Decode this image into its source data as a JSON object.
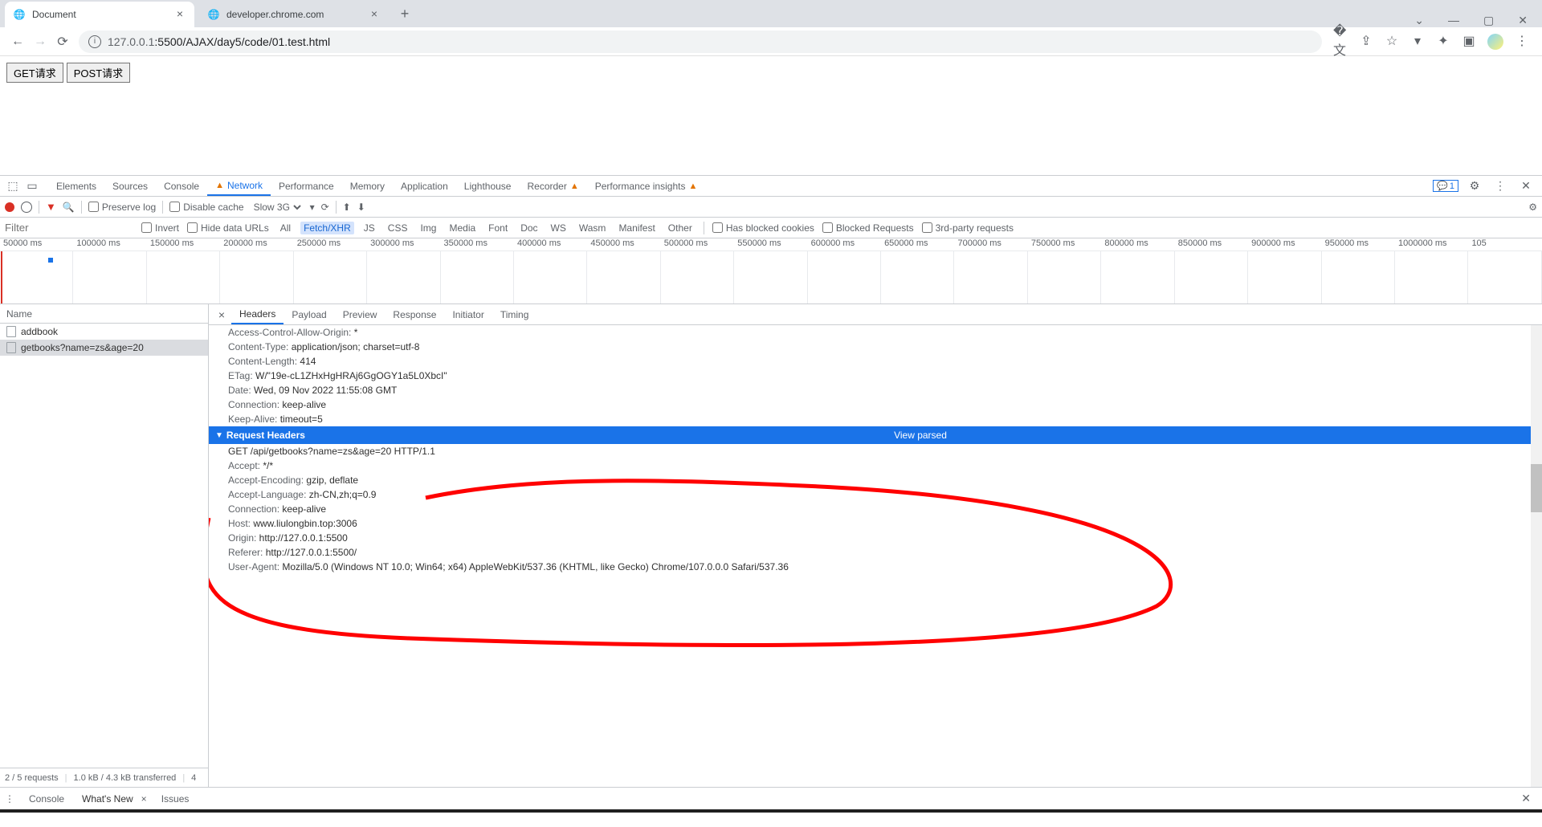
{
  "tabs": [
    {
      "title": "Document",
      "favicon": "globe"
    },
    {
      "title": "developer.chrome.com",
      "favicon": "globe"
    }
  ],
  "url": {
    "host": "127.0.0.1",
    "port": ":5500",
    "path": "/AJAX/day5/code/01.test.html"
  },
  "page_buttons": {
    "get": "GET请求",
    "post": "POST请求"
  },
  "devtools": {
    "panels": [
      "Elements",
      "Sources",
      "Console",
      "Network",
      "Performance",
      "Memory",
      "Application",
      "Lighthouse",
      "Recorder",
      "Performance insights"
    ],
    "active_panel": "Network",
    "msg_count": "1",
    "toolbar": {
      "preserve": "Preserve log",
      "disable_cache": "Disable cache",
      "throttle": "Slow 3G"
    },
    "filter": {
      "placeholder": "Filter",
      "invert": "Invert",
      "hide": "Hide data URLs",
      "types": [
        "All",
        "Fetch/XHR",
        "JS",
        "CSS",
        "Img",
        "Media",
        "Font",
        "Doc",
        "WS",
        "Wasm",
        "Manifest",
        "Other"
      ],
      "active_type": "Fetch/XHR",
      "blocked_cookies": "Has blocked cookies",
      "blocked_req": "Blocked Requests",
      "third": "3rd-party requests"
    },
    "timeline_ticks": [
      "50000 ms",
      "100000 ms",
      "150000 ms",
      "200000 ms",
      "250000 ms",
      "300000 ms",
      "350000 ms",
      "400000 ms",
      "450000 ms",
      "500000 ms",
      "550000 ms",
      "600000 ms",
      "650000 ms",
      "700000 ms",
      "750000 ms",
      "800000 ms",
      "850000 ms",
      "900000 ms",
      "950000 ms",
      "1000000 ms",
      "105"
    ],
    "requests": {
      "header": "Name",
      "rows": [
        "addbook",
        "getbooks?name=zs&age=20"
      ],
      "selected": 1,
      "status": {
        "count": "2 / 5 requests",
        "transferred": "1.0 kB / 4.3 kB transferred",
        "more": "4"
      }
    },
    "detail": {
      "tabs": [
        "Headers",
        "Payload",
        "Preview",
        "Response",
        "Initiator",
        "Timing"
      ],
      "active": "Headers",
      "response_headers": [
        [
          "Access-Control-Allow-Origin:",
          " *"
        ],
        [
          "Content-Type:",
          " application/json; charset=utf-8"
        ],
        [
          "Content-Length:",
          " 414"
        ],
        [
          "ETag:",
          " W/\"19e-cL1ZHxHgHRAj6GgOGY1a5L0XbcI\""
        ],
        [
          "Date:",
          " Wed, 09 Nov 2022 11:55:08 GMT"
        ],
        [
          "Connection:",
          " keep-alive"
        ],
        [
          "Keep-Alive:",
          " timeout=5"
        ]
      ],
      "req_section": {
        "title": "Request Headers",
        "action": "View parsed"
      },
      "request_headers": [
        [
          "",
          "GET /api/getbooks?name=zs&age=20 HTTP/1.1"
        ],
        [
          "Accept:",
          " */*"
        ],
        [
          "Accept-Encoding:",
          " gzip, deflate"
        ],
        [
          "Accept-Language:",
          " zh-CN,zh;q=0.9"
        ],
        [
          "Connection:",
          " keep-alive"
        ],
        [
          "Host:",
          " www.liulongbin.top:3006"
        ],
        [
          "Origin:",
          " http://127.0.0.1:5500"
        ],
        [
          "Referer:",
          " http://127.0.0.1:5500/"
        ],
        [
          "User-Agent:",
          " Mozilla/5.0 (Windows NT 10.0; Win64; x64) AppleWebKit/537.36 (KHTML, like Gecko) Chrome/107.0.0.0 Safari/537.36"
        ]
      ]
    },
    "drawer": {
      "tabs": [
        "Console",
        "What's New",
        "Issues"
      ],
      "active": "What's New"
    }
  }
}
